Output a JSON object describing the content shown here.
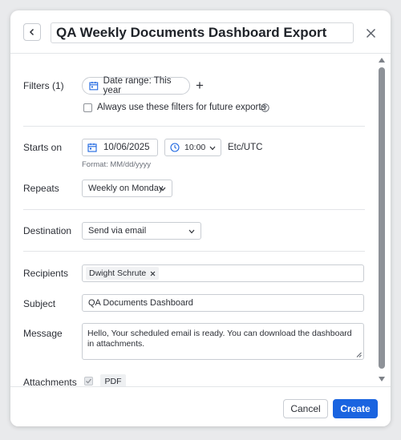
{
  "header": {
    "title_value": "QA Weekly Documents Dashboard Export"
  },
  "filters": {
    "label": "Filters (1)",
    "chip_label": "Date range: This year",
    "add_symbol": "+",
    "always_use_label": "Always use these filters for future exports",
    "always_use_checked": false
  },
  "schedule": {
    "starts_on_label": "Starts on",
    "date_value": "10/06/2025",
    "time_value": "10:00",
    "timezone": "Etc/UTC",
    "format_hint": "Format: MM/dd/yyyy",
    "repeats_label": "Repeats",
    "repeats_value": "Weekly on Monday"
  },
  "destination": {
    "label": "Destination",
    "value": "Send via email"
  },
  "email": {
    "recipients_label": "Recipients",
    "recipients": [
      "Dwight Schrute"
    ],
    "subject_label": "Subject",
    "subject_value": "QA Documents Dashboard",
    "message_label": "Message",
    "message_value": "Hello, Your scheduled email is ready. You can download the dashboard in attachments.",
    "attachments_label": "Attachments",
    "attachment_format": "PDF",
    "attachment_checked": true
  },
  "footer": {
    "cancel_label": "Cancel",
    "create_label": "Create"
  },
  "colors": {
    "primary": "#1a64e0",
    "border": "#c9cdd3"
  }
}
